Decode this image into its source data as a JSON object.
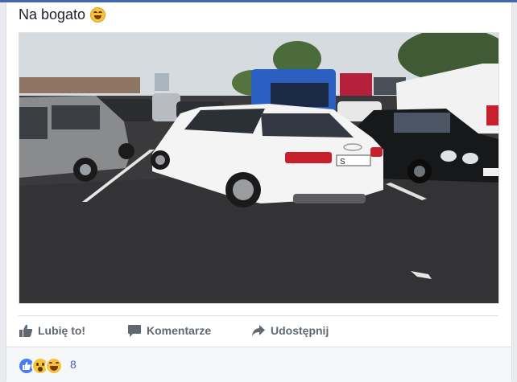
{
  "post": {
    "text": "Na bogato",
    "text_emoji": "laughing-emoji",
    "image_alt": "Parking lot photo"
  },
  "photo_plate_text": "S",
  "actions": {
    "like": "Lubię to!",
    "comment": "Komentarze",
    "share": "Udostępnij"
  },
  "reactions": {
    "icons": [
      "like-reaction-icon",
      "wow-reaction-icon",
      "haha-reaction-icon"
    ],
    "count": "8"
  },
  "colors": {
    "brand": "#4267b2",
    "action_text": "#616770",
    "post_text": "#1d2129"
  }
}
